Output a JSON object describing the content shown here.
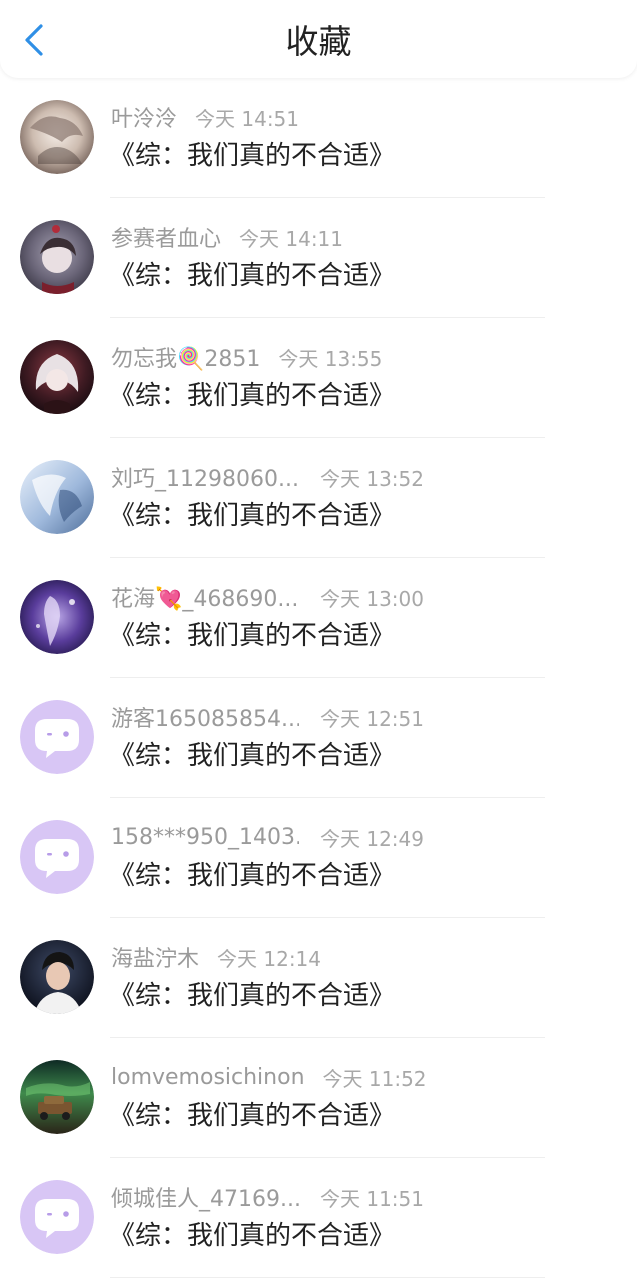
{
  "header": {
    "title": "收藏",
    "back_icon": "chevron-left-icon",
    "accent_color": "#2f8fe6"
  },
  "items": [
    {
      "name": "叶泠泠",
      "time": "今天 14:51",
      "content": "《综：我们真的不合适》",
      "avatar": "avatar-photo-icon"
    },
    {
      "name": "参赛者血心",
      "time": "今天 14:11",
      "content": "《综：我们真的不合适》",
      "avatar": "avatar-photo-icon"
    },
    {
      "name": "勿忘我🍭2851",
      "time": "今天 13:55",
      "content": "《综：我们真的不合适》",
      "avatar": "avatar-photo-icon"
    },
    {
      "name": "刘巧_11298060...",
      "time": "今天 13:52",
      "content": "《综：我们真的不合适》",
      "avatar": "avatar-photo-icon"
    },
    {
      "name": "花海💘_468690...",
      "time": "今天 13:00",
      "content": "《综：我们真的不合适》",
      "avatar": "avatar-photo-icon"
    },
    {
      "name": "游客165085854...",
      "time": "今天 12:51",
      "content": "《综：我们真的不合适》",
      "avatar": "default-avatar-icon"
    },
    {
      "name": "158***950_1403...",
      "time": "今天 12:49",
      "content": "《综：我们真的不合适》",
      "avatar": "default-avatar-icon"
    },
    {
      "name": "海盐泞木",
      "time": "今天 12:14",
      "content": "《综：我们真的不合适》",
      "avatar": "avatar-photo-icon"
    },
    {
      "name": "lomvemosichinon",
      "time": "今天 11:52",
      "content": "《综：我们真的不合适》",
      "avatar": "avatar-photo-icon"
    },
    {
      "name": "倾城佳人_47169...",
      "time": "今天 11:51",
      "content": "《综：我们真的不合适》",
      "avatar": "default-avatar-icon"
    }
  ],
  "colors": {
    "default_avatar_bg": "#d8c6f5",
    "name_text": "#9a9a9a",
    "content_text": "#222222"
  }
}
